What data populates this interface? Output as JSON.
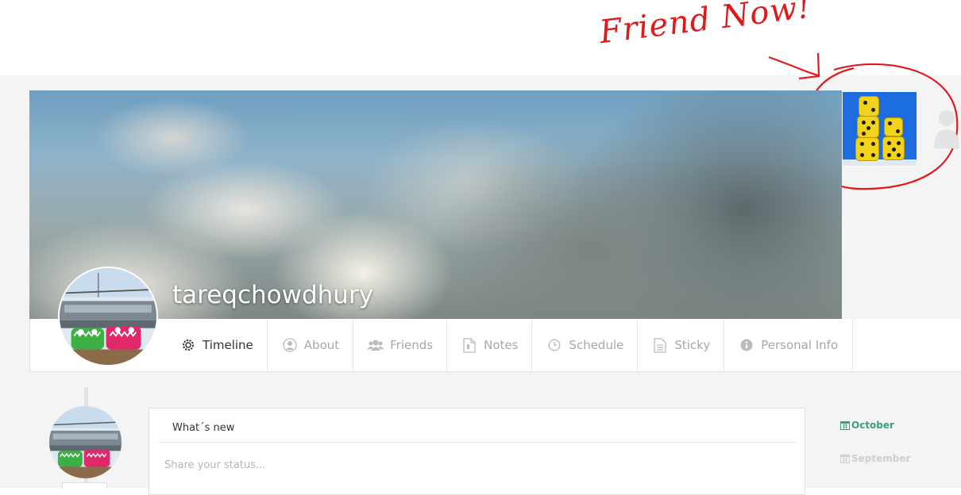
{
  "annotation": {
    "text": "Friend Now!",
    "color": "#e01a1a"
  },
  "profile": {
    "username": "tareqchowdhury"
  },
  "nav": {
    "tabs": [
      {
        "label": "Timeline",
        "icon": "gear-icon"
      },
      {
        "label": "About",
        "icon": "user-icon"
      },
      {
        "label": "Friends",
        "icon": "users-icon"
      },
      {
        "label": "Notes",
        "icon": "file-icon"
      },
      {
        "label": "Schedule",
        "icon": "clock-icon"
      },
      {
        "label": "Sticky",
        "icon": "note-icon"
      },
      {
        "label": "Personal Info",
        "icon": "info-icon"
      }
    ]
  },
  "composer": {
    "title": "What´s new",
    "placeholder": "Share your status..."
  },
  "archive": {
    "months": [
      {
        "label": "October",
        "active": true
      },
      {
        "label": "September",
        "active": false
      }
    ],
    "accent_color": "#3e9e7e"
  }
}
